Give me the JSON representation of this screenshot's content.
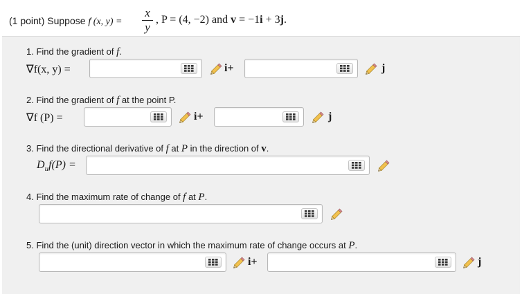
{
  "header": {
    "prefix": "(1 point) Suppose ",
    "f_sym": "f",
    "f_args": " (x, y) = ",
    "frac_num": "x",
    "frac_den": "y",
    "point_text": ", P = (4, −2) and ",
    "v_sym": "v",
    "v_expr": " = −1",
    "i_sym": "i",
    "plus3": " + 3",
    "j_sym": "j",
    "period": "."
  },
  "q1": {
    "text": "1. Find the gradient of ",
    "f": "f",
    "end": ".",
    "label": "∇f(x, y) =",
    "unit_i": "i+",
    "unit_j": "j"
  },
  "q2": {
    "text": "2. Find the gradient of ",
    "f": "f",
    "mid": " at the point P.",
    "label": "∇f (P) =",
    "unit_i": "i+",
    "unit_j": "j"
  },
  "q3": {
    "text": "3. Find the directional derivative of ",
    "f": "f",
    "at": " at ",
    "p": "P",
    "dir": " in the direction of ",
    "v": "v",
    "end": ".",
    "label": "D",
    "label_sub": "u",
    "label_rest": "f(P) ="
  },
  "q4": {
    "text": "4. Find the maximum rate of change of ",
    "f": "f",
    "at": " at ",
    "p": "P",
    "end": "."
  },
  "q5": {
    "text": "5. Find the (unit) direction vector in which the maximum rate of change occurs at ",
    "p": "P",
    "end": ".",
    "unit_i": "i+",
    "unit_j": "j"
  },
  "inputs": {
    "q1_i": "",
    "q1_j": "",
    "q2_i": "",
    "q2_j": "",
    "q3": "",
    "q4": "",
    "q5_i": "",
    "q5_j": ""
  },
  "icons": {
    "grid": "grid-icon",
    "pencil": "pencil-icon"
  }
}
